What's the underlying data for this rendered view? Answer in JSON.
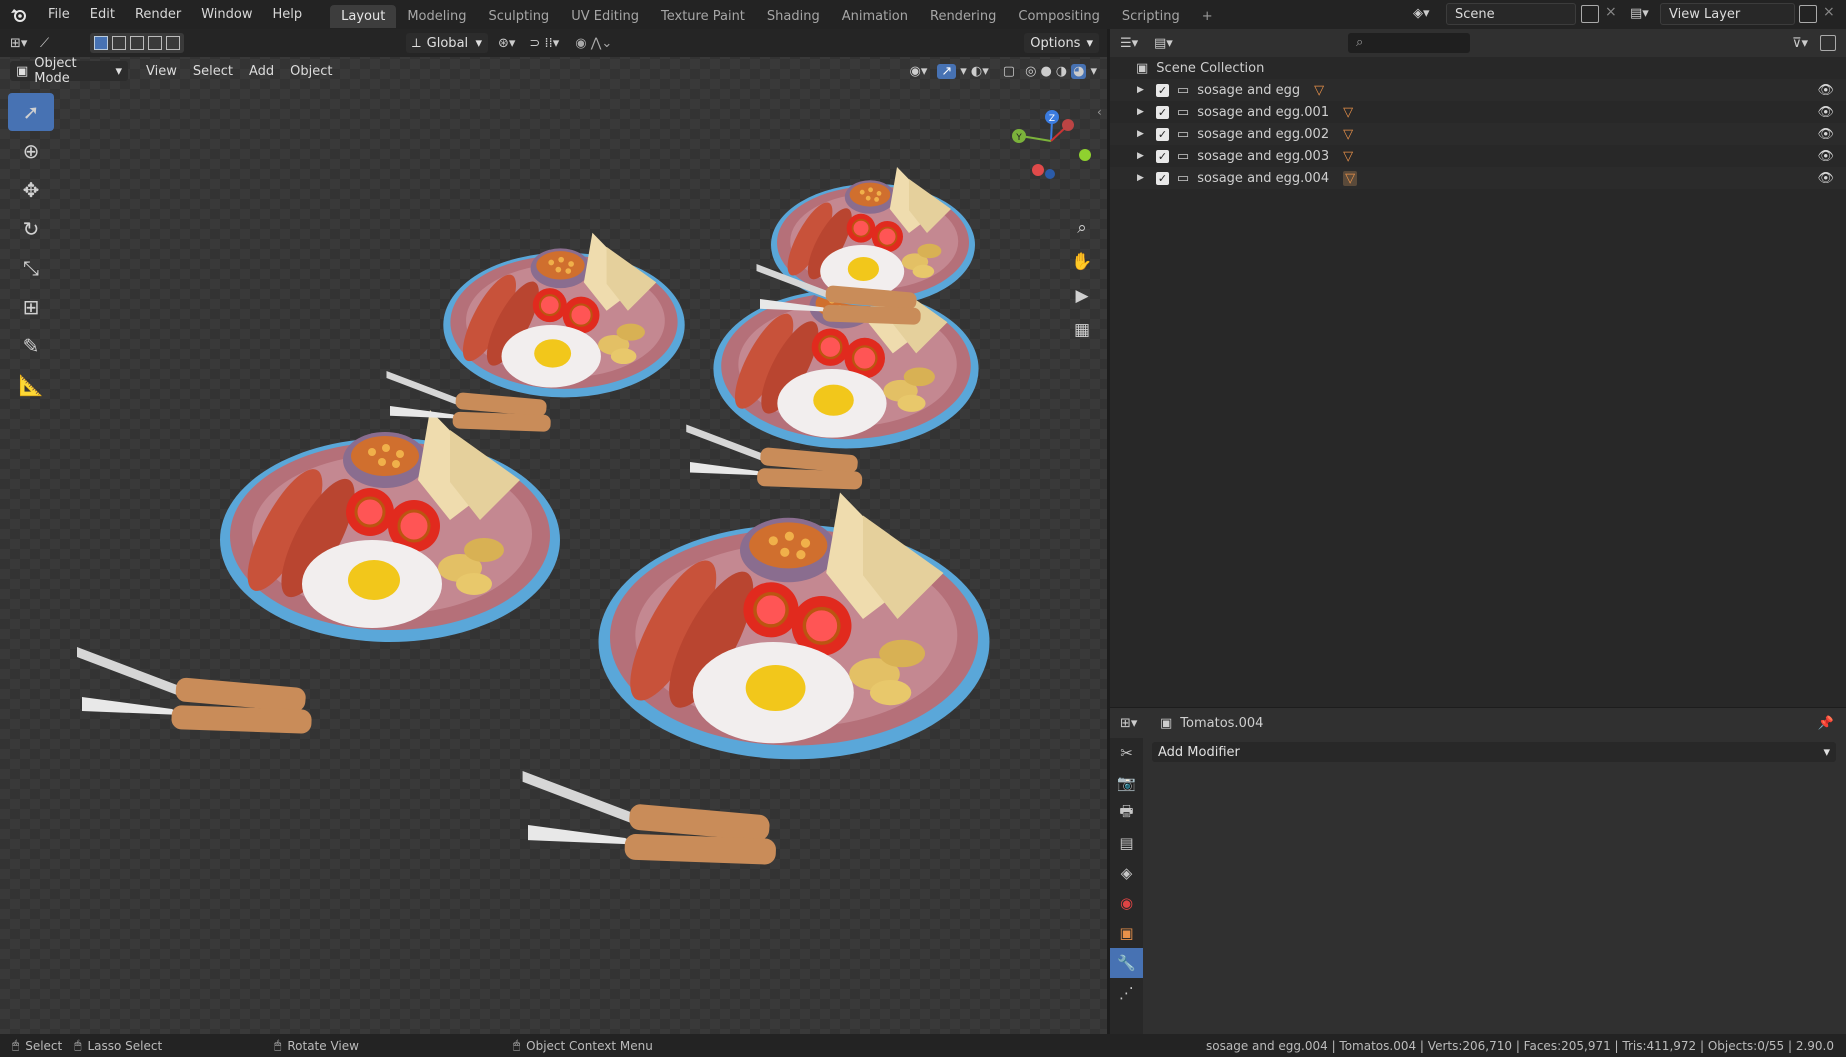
{
  "menubar": {
    "items": [
      "File",
      "Edit",
      "Render",
      "Window",
      "Help"
    ]
  },
  "workspaces": {
    "tabs": [
      "Layout",
      "Modeling",
      "Sculpting",
      "UV Editing",
      "Texture Paint",
      "Shading",
      "Animation",
      "Rendering",
      "Compositing",
      "Scripting"
    ],
    "active": "Layout",
    "add": "+"
  },
  "scene": {
    "label": "Scene"
  },
  "view_layer": {
    "label": "View Layer"
  },
  "viewport": {
    "orientation": "Global",
    "options": "Options",
    "mode": "Object Mode",
    "menu": [
      "View",
      "Select",
      "Add",
      "Object"
    ]
  },
  "gizmo": {
    "z": "Z",
    "y": "Y"
  },
  "outliner": {
    "root": "Scene Collection",
    "items": [
      "sosage and egg",
      "sosage and egg.001",
      "sosage and egg.002",
      "sosage and egg.003",
      "sosage and egg.004"
    ]
  },
  "properties": {
    "object": "Tomatos.004",
    "add_modifier": "Add Modifier"
  },
  "statusbar": {
    "select": "Select",
    "lasso": "Lasso Select",
    "rotate": "Rotate View",
    "context": "Object Context Menu",
    "stats": "sosage and egg.004 | Tomatos.004 | Verts:206,710 | Faces:205,971 | Tris:411,972 | Objects:0/55 | 2.90.0"
  },
  "icons": [
    "blender-logo",
    "select-box-icon",
    "cursor-icon",
    "move-icon",
    "rotate-icon",
    "scale-icon",
    "transform-icon",
    "annotate-icon",
    "measure-icon",
    "zoom-icon",
    "hand-icon",
    "camera-icon",
    "grid-icon",
    "eye-icon",
    "wrench-icon"
  ]
}
